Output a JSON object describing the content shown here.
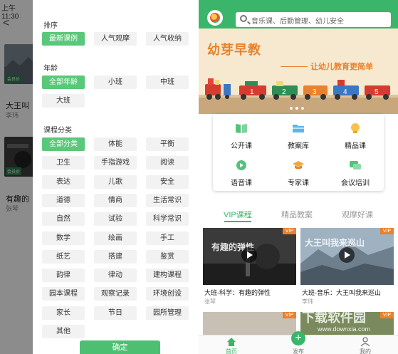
{
  "status_bar": {
    "time": "上午11:30"
  },
  "underlying_list": {
    "back_glyph": "<",
    "items": [
      {
        "title": "大王叫",
        "author": "李玮",
        "badge": "会员价"
      },
      {
        "title": "有趣的",
        "author": "张琴",
        "badge": "会员价"
      }
    ]
  },
  "filter_panel": {
    "sort": {
      "title": "排序",
      "options": [
        "最新课例",
        "人气观摩",
        "人气收纳"
      ],
      "selected": 0
    },
    "age": {
      "title": "年龄",
      "options": [
        "全部年龄",
        "小班",
        "中班",
        "大班"
      ],
      "selected": 0
    },
    "category": {
      "title": "课程分类",
      "options": [
        "全部分类",
        "体能",
        "平衡",
        "卫生",
        "手指游戏",
        "阅读",
        "表达",
        "儿歌",
        "安全",
        "道德",
        "情商",
        "生活常识",
        "自然",
        "试验",
        "科学常识",
        "数学",
        "绘画",
        "手工",
        "纸艺",
        "搭建",
        "鉴赏",
        "韵律",
        "律动",
        "建构课程",
        "园本课程",
        "观察记录",
        "环境创设",
        "家长",
        "节日",
        "园所管理",
        "其他"
      ],
      "selected": 0
    },
    "confirm_label": "确定"
  },
  "app": {
    "search_placeholder": "音乐课、后勤管理、幼儿安全",
    "banner": {
      "title": "幼芽早教",
      "subtitle": "让幼儿教育更简单",
      "train_numbers": [
        "1",
        "2",
        "3",
        "4",
        "5"
      ]
    },
    "menu": [
      {
        "label": "公开课",
        "icon": "book-icon"
      },
      {
        "label": "教案库",
        "icon": "folder-icon"
      },
      {
        "label": "精品课",
        "icon": "lightbulb-icon"
      },
      {
        "label": "语音课",
        "icon": "voice-icon"
      },
      {
        "label": "专家课",
        "icon": "graduation-cap-icon"
      },
      {
        "label": "会议培训",
        "icon": "chat-icon"
      }
    ],
    "tabs": [
      "VIP课程",
      "精品教案",
      "观摩好课"
    ],
    "active_tab": 0,
    "vip_badge": "VIP",
    "videos": [
      {
        "title": "大班-科学：有趣的弹性",
        "author": "张琴",
        "thumb_text": "有趣的弹性"
      },
      {
        "title": "大班-音乐：大王叫我来巡山",
        "author": "李玮",
        "thumb_text": "大王叫我来巡山"
      }
    ],
    "bottom_nav": [
      {
        "label": "首页",
        "icon": "home-icon"
      },
      {
        "label": "发布",
        "icon": "plus-icon"
      },
      {
        "label": "我的",
        "icon": "user-icon"
      }
    ],
    "watermark": {
      "text": "下载软件园",
      "url": "www.downxia.com"
    }
  },
  "colors": {
    "brand_green": "#3bb56a",
    "chip_selected": "#5ac87a",
    "banner_orange": "#e8822e"
  }
}
